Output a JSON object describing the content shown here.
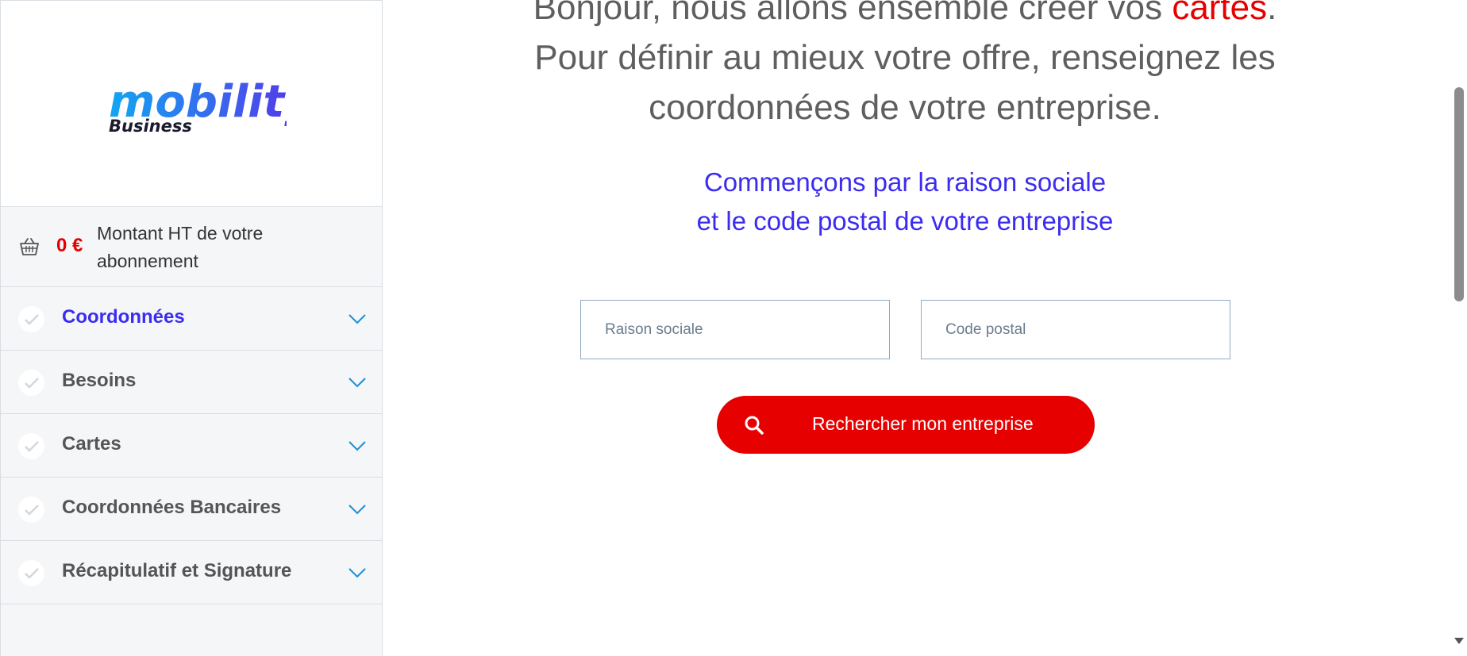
{
  "brand": {
    "logo_text": "mobility",
    "logo_subtext": "Business",
    "logo_gradient": [
      "#13a6f2",
      "#5a2ee8"
    ]
  },
  "sidebar": {
    "amount": {
      "icon": "basket-icon",
      "value": "0 €",
      "label": "Montant HT de votre abonnement"
    },
    "steps": [
      {
        "label": "Coordonnées",
        "active": true,
        "icon": "check-icon"
      },
      {
        "label": "Besoins",
        "active": false,
        "icon": "check-icon"
      },
      {
        "label": "Cartes",
        "active": false,
        "icon": "check-icon"
      },
      {
        "label": "Coordonnées Bancaires",
        "active": false,
        "icon": "check-icon"
      },
      {
        "label": "Récapitulatif et Signature",
        "active": false,
        "icon": "check-icon"
      }
    ]
  },
  "main": {
    "intro_line1_prefix": "Bonjour, nous allons ensemble créer vos ",
    "intro_line1_accent": "cartes",
    "intro_line1_suffix": ".",
    "intro_line2": "Pour définir au mieux votre offre, renseignez les",
    "intro_line3": "coordonnées de votre entreprise.",
    "subhead_line1": "Commençons par la raison sociale",
    "subhead_line2": "et le code postal de votre entreprise",
    "fields": {
      "company_placeholder": "Raison sociale",
      "company_value": "",
      "postal_placeholder": "Code postal",
      "postal_value": ""
    },
    "search_button": {
      "label": "Rechercher mon entreprise",
      "icon": "search-icon"
    }
  },
  "colors": {
    "accent_red": "#e60000",
    "accent_blue": "#3b2cf0",
    "sidebar_bg": "#f5f6f8"
  }
}
